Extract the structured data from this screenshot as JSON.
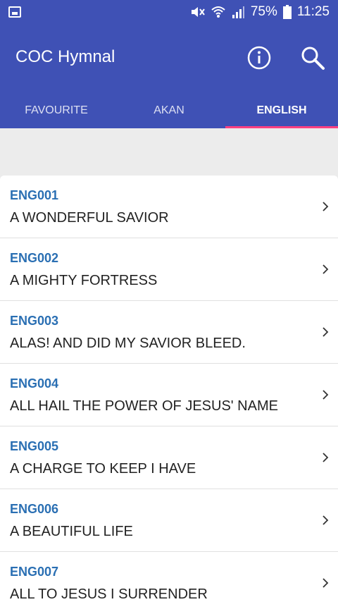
{
  "status": {
    "battery": "75%",
    "time": "11:25"
  },
  "app": {
    "title": "COC Hymnal"
  },
  "tabs": [
    {
      "label": "FAVOURITE"
    },
    {
      "label": "AKAN"
    },
    {
      "label": "ENGLISH",
      "active": true
    }
  ],
  "hymns": [
    {
      "code": "ENG001",
      "title": "A WONDERFUL SAVIOR"
    },
    {
      "code": "ENG002",
      "title": "A MIGHTY FORTRESS"
    },
    {
      "code": "ENG003",
      "title": "ALAS! AND DID MY SAVIOR BLEED."
    },
    {
      "code": "ENG004",
      "title": "ALL HAIL THE POWER OF JESUS' NAME"
    },
    {
      "code": "ENG005",
      "title": "A CHARGE TO KEEP I HAVE"
    },
    {
      "code": "ENG006",
      "title": "A BEAUTIFUL LIFE"
    },
    {
      "code": "ENG007",
      "title": "ALL TO JESUS I SURRENDER"
    }
  ],
  "colors": {
    "primary": "#3f51b5",
    "accent": "#ff4081",
    "code_text": "#2a6fb3"
  },
  "icons": [
    "screenshot-icon",
    "mute-icon",
    "wifi-icon",
    "signal-icon",
    "battery-icon",
    "info-icon",
    "search-icon",
    "chevron-right-icon"
  ]
}
